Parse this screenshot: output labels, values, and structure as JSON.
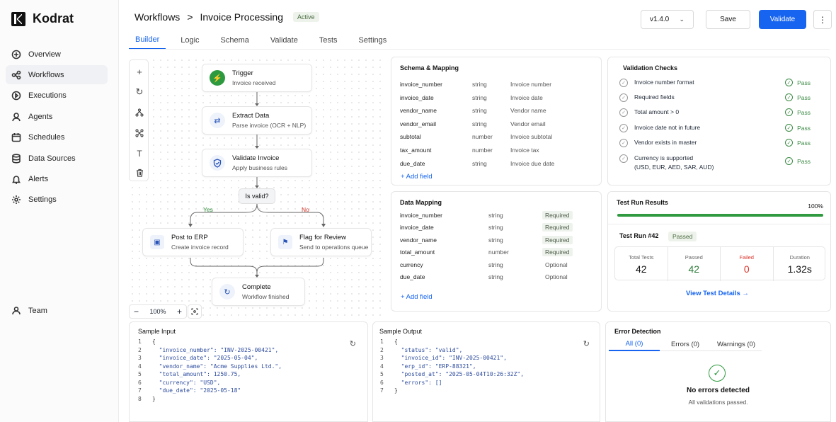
{
  "app": {
    "name": "Kodrat"
  },
  "sidebar": {
    "items": [
      {
        "label": "Overview",
        "icon": "overview-icon"
      },
      {
        "label": "Workflows",
        "icon": "workflows-icon",
        "active": true
      },
      {
        "label": "Executions",
        "icon": "play-icon"
      },
      {
        "label": "Agents",
        "icon": "agents-icon"
      },
      {
        "label": "Schedules",
        "icon": "calendar-icon"
      },
      {
        "label": "Data Sources",
        "icon": "database-icon"
      },
      {
        "label": "Alerts",
        "icon": "bell-icon"
      },
      {
        "label": "Settings",
        "icon": "gear-icon"
      }
    ],
    "team": "Team"
  },
  "header": {
    "breadcrumb_root": "Workflows",
    "breadcrumb_sep": ">",
    "title": "Invoice Processing",
    "status": "Active",
    "version": "v1.4.0",
    "save": "Save",
    "validate": "Validate",
    "more": "⋮"
  },
  "tabs": [
    "Builder",
    "Logic",
    "Schema",
    "Validate",
    "Tests",
    "Settings"
  ],
  "flow": {
    "trigger": {
      "title": "Trigger",
      "sub": "Invoice received"
    },
    "extract": {
      "title": "Extract Data",
      "sub": "Parse invoice (OCR + NLP)"
    },
    "validate": {
      "title": "Validate Invoice",
      "sub": "Apply business rules"
    },
    "decision": "Is valid?",
    "yes": "Yes",
    "no": "No",
    "erp": {
      "title": "Post to ERP",
      "sub": "Create invoice record"
    },
    "review": {
      "title": "Flag for Review",
      "sub": "Send to operations queue"
    },
    "complete": {
      "title": "Complete",
      "sub": "Workflow finished"
    },
    "zoom": "100%"
  },
  "schema": {
    "title": "Schema & Mapping",
    "rows": [
      [
        "invoice_number",
        "string",
        "Invoice number"
      ],
      [
        "invoice_date",
        "string",
        "Invoice date"
      ],
      [
        "vendor_name",
        "string",
        "Vendor name"
      ],
      [
        "vendor_email",
        "string",
        "Vendor email"
      ],
      [
        "subtotal",
        "number",
        "Invoice subtotal"
      ],
      [
        "tax_amount",
        "number",
        "Invoice tax"
      ],
      [
        "due_date",
        "string",
        "Invoice due date"
      ]
    ],
    "add": "+ Add field"
  },
  "mapping": {
    "title": "Data Mapping",
    "rows": [
      [
        "invoice_number",
        "string",
        "Required"
      ],
      [
        "invoice_date",
        "string",
        "Required"
      ],
      [
        "vendor_name",
        "string",
        "Required"
      ],
      [
        "total_amount",
        "number",
        "Required"
      ],
      [
        "currency",
        "string",
        "Optional"
      ],
      [
        "due_date",
        "string",
        "Optional"
      ]
    ],
    "add": "+ Add field"
  },
  "checks": {
    "title": "Validation Checks",
    "items": [
      {
        "label": "Invoice number format",
        "sub": "",
        "status": "Pass"
      },
      {
        "label": "Required fields",
        "sub": "",
        "status": "Pass"
      },
      {
        "label": "Total amount > 0",
        "sub": "",
        "status": "Pass"
      },
      {
        "label": "Invoice date not in future",
        "sub": "",
        "status": "Pass"
      },
      {
        "label": "Vendor exists in master",
        "sub": "",
        "status": "Pass"
      },
      {
        "label": "Currency is supported",
        "sub": "(USD, EUR, AED, SAR, AUD)",
        "status": "Pass"
      }
    ]
  },
  "test_run": {
    "title": "Test Run Results",
    "progress_label": "100%",
    "progress": 1.0,
    "run": "Test Run #42",
    "badge": "Passed",
    "stats": [
      {
        "label": "Total Tests",
        "value": "42",
        "color": "#111111"
      },
      {
        "label": "Passed",
        "value": "42",
        "color": "#2f7d3a"
      },
      {
        "label": "Failed",
        "value": "0",
        "color": "#d9342b"
      },
      {
        "label": "Duration",
        "value": "1.32s",
        "color": "#111111"
      }
    ],
    "details": "View Test Details →"
  },
  "sample_input": {
    "title": "Sample Input",
    "lines": [
      "{",
      "  \"invoice_number\": \"INV-2025-00421\",",
      "  \"invoice_date\": \"2025-05-04\",",
      "  \"vendor_name\": \"Acme Supplies Ltd.\",",
      "  \"total_amount\": 1250.75,",
      "  \"currency\": \"USD\",",
      "  \"due_date\": \"2025-05-18\"",
      "}"
    ]
  },
  "sample_output": {
    "title": "Sample Output",
    "lines": [
      "{",
      "  \"status\": \"valid\",",
      "  \"invoice_id\": \"INV-2025-00421\",",
      "  \"erp_id\": \"ERP-88321\",",
      "  \"posted_at\": \"2025-05-04T10:26:32Z\",",
      "  \"errors\": []",
      "}"
    ]
  },
  "errors": {
    "title": "Error Detection",
    "tabs": [
      "All (0)",
      "Errors (0)",
      "Warnings (0)"
    ],
    "headline": "No errors detected",
    "sub": "All validations passed."
  },
  "colors": {
    "accent": "#1664ef",
    "success": "#2f9a3f",
    "fail": "#d9342b"
  }
}
